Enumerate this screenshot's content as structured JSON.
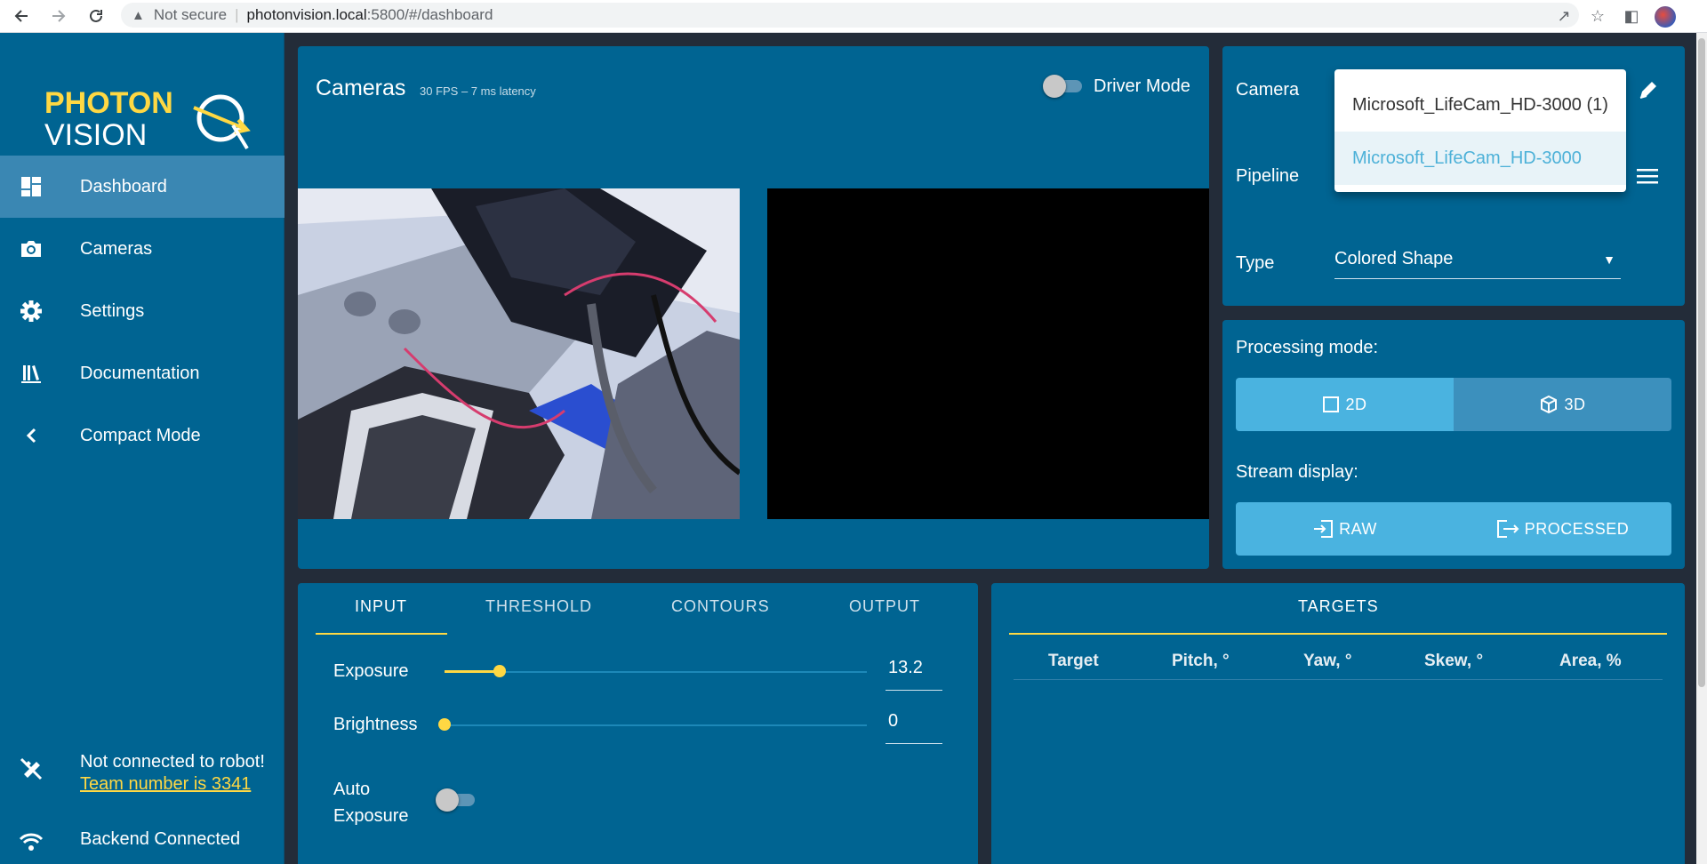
{
  "browser": {
    "security_label": "Not secure",
    "url_host": "photonvision.local",
    "url_rest": ":5800/#/dashboard"
  },
  "brand": {
    "line1": "PHOTON",
    "line2": "VISION"
  },
  "sidebar": {
    "items": [
      {
        "label": "Dashboard",
        "icon": "dashboard-icon"
      },
      {
        "label": "Cameras",
        "icon": "camera-icon"
      },
      {
        "label": "Settings",
        "icon": "gear-icon"
      },
      {
        "label": "Documentation",
        "icon": "library-books-icon"
      },
      {
        "label": "Compact Mode",
        "icon": "chevron-left-icon"
      }
    ],
    "robot_status": "Not connected to robot!",
    "team_link": "Team number is 3341",
    "backend_status": "Backend Connected"
  },
  "cameras_panel": {
    "title": "Cameras",
    "stats": "30 FPS – 7 ms latency",
    "driver_mode_label": "Driver Mode",
    "driver_mode_on": false
  },
  "config_panel": {
    "camera_label": "Camera",
    "pipeline_label": "Pipeline",
    "type_label": "Type",
    "type_value": "Colored Shape",
    "camera_options": [
      "Microsoft_LifeCam_HD-3000 (1)",
      "Microsoft_LifeCam_HD-3000"
    ],
    "camera_selected_index": 1
  },
  "mode_panel": {
    "processing_label": "Processing mode:",
    "processing_options": [
      "2D",
      "3D"
    ],
    "processing_selected": "2D",
    "stream_label": "Stream display:",
    "stream_options": [
      "RAW",
      "PROCESSED"
    ]
  },
  "tabs": {
    "items": [
      "INPUT",
      "THRESHOLD",
      "CONTOURS",
      "OUTPUT"
    ],
    "active": "INPUT"
  },
  "input_tab": {
    "exposure_label": "Exposure",
    "exposure_value": "13.2",
    "exposure_fraction": 0.13,
    "brightness_label": "Brightness",
    "brightness_value": "0",
    "brightness_fraction": 0.0,
    "auto_exposure_line1": "Auto",
    "auto_exposure_line2": "Exposure",
    "auto_exposure_on": false
  },
  "targets": {
    "title": "TARGETS",
    "columns": [
      "Target",
      "Pitch, °",
      "Yaw, °",
      "Skew, °",
      "Area, %"
    ]
  },
  "colors": {
    "panel": "#006492",
    "background": "#232c39",
    "accent": "#ffd843",
    "active_nav": "#3a87b3",
    "segment_on": "#4ab3e0"
  }
}
